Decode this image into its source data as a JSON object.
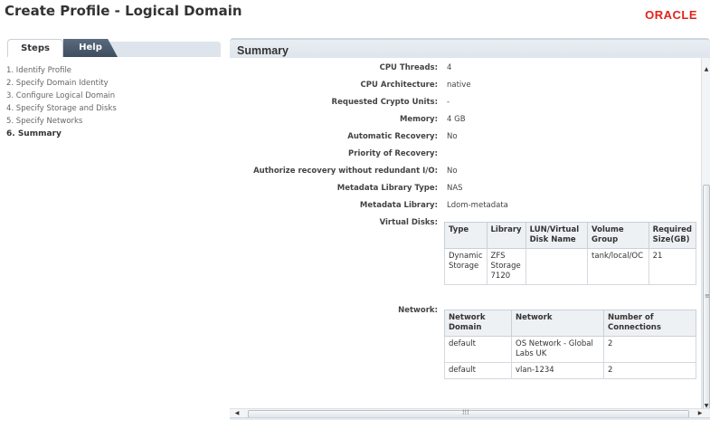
{
  "header": {
    "title": "Create Profile - Logical Domain",
    "logo": "ORACLE"
  },
  "sidebar": {
    "tabs": [
      "Steps",
      "Help"
    ],
    "steps": [
      {
        "label": "1.  Identify Profile"
      },
      {
        "label": "2.  Specify Domain Identity"
      },
      {
        "label": "3.  Configure Logical Domain"
      },
      {
        "label": "4.  Specify Storage and Disks"
      },
      {
        "label": "5.  Specify Networks"
      },
      {
        "label": "6.  Summary"
      }
    ]
  },
  "summary": {
    "title": "Summary",
    "properties": [
      {
        "label": "CPU Threads:",
        "value": "4"
      },
      {
        "label": "CPU Architecture:",
        "value": "native"
      },
      {
        "label": "Requested Crypto Units:",
        "value": "-"
      },
      {
        "label": "Memory:",
        "value": "4 GB"
      },
      {
        "label": "Automatic Recovery:",
        "value": "No"
      },
      {
        "label": "Priority of Recovery:",
        "value": ""
      },
      {
        "label": "Authorize recovery without redundant I/O:",
        "value": "No"
      },
      {
        "label": "Metadata Library Type:",
        "value": "NAS"
      },
      {
        "label": "Metadata Library:",
        "value": "Ldom-metadata"
      }
    ],
    "virtual_disks": {
      "label": "Virtual Disks:",
      "headers": [
        "Type",
        "Library",
        "LUN/Virtual Disk Name",
        "Volume Group",
        "Required Size(GB)"
      ],
      "rows": [
        [
          "Dynamic Storage",
          "ZFS Storage 7120",
          "",
          "tank/local/OC",
          "21"
        ]
      ]
    },
    "network": {
      "label": "Network:",
      "headers": [
        "Network Domain",
        "Network",
        "Number of Connections"
      ],
      "rows": [
        [
          "default",
          "OS Network - Global Labs UK",
          "2"
        ],
        [
          "default",
          "vlan-1234",
          "2"
        ]
      ]
    }
  },
  "colors": {
    "logo": "#e2231a",
    "help_tab": "#4a5a6c",
    "panel_header": "#e4e9ef"
  }
}
